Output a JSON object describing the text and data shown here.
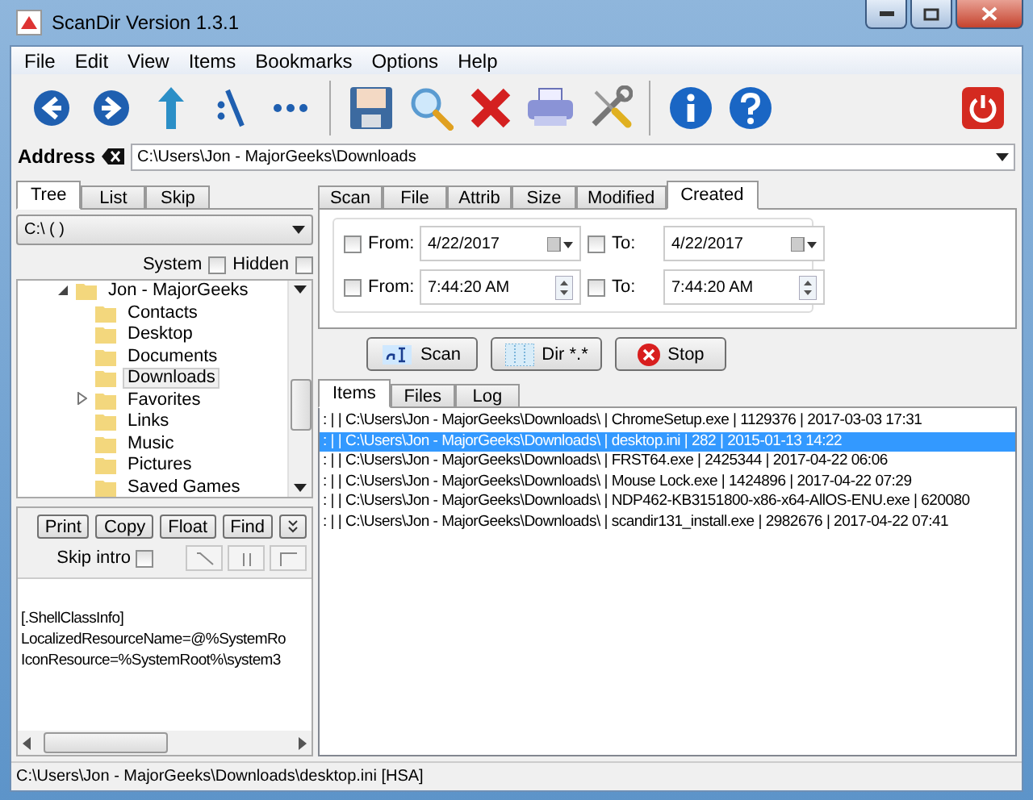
{
  "window": {
    "title": "ScanDir Version 1.3.1"
  },
  "menu": [
    "File",
    "Edit",
    "View",
    "Items",
    "Bookmarks",
    "Options",
    "Help"
  ],
  "address": {
    "label": "Address",
    "value": "C:\\Users\\Jon - MajorGeeks\\Downloads"
  },
  "left_tabs": [
    {
      "label": "Tree",
      "selected": true
    },
    {
      "label": "List",
      "selected": false
    },
    {
      "label": "Skip",
      "selected": false
    }
  ],
  "drive": "C:\\ ( )",
  "tree_options": [
    {
      "label": "System",
      "checked": false
    },
    {
      "label": "Hidden",
      "checked": false
    }
  ],
  "tree": [
    {
      "label": "Jon - MajorGeeks",
      "expanded": true,
      "selected": false,
      "children": [
        {
          "label": "Contacts",
          "selected": false
        },
        {
          "label": "Desktop",
          "selected": false
        },
        {
          "label": "Documents",
          "selected": false
        },
        {
          "label": "Downloads",
          "selected": true
        },
        {
          "label": "Favorites",
          "selected": false,
          "expanded": false
        },
        {
          "label": "Links",
          "selected": false
        },
        {
          "label": "Music",
          "selected": false
        },
        {
          "label": "Pictures",
          "selected": false
        },
        {
          "label": "Saved Games",
          "selected": false
        }
      ]
    }
  ],
  "preview_buttons": [
    "Print",
    "Copy",
    "Float",
    "Find"
  ],
  "skip_intro": {
    "label": "Skip intro",
    "checked": false
  },
  "preview_lines": [
    "[.ShellClassInfo]",
    "LocalizedResourceName=@%SystemRo",
    "IconResource=%SystemRoot%\\system3"
  ],
  "right_tabs": [
    {
      "label": "Scan",
      "selected": false
    },
    {
      "label": "File",
      "selected": false
    },
    {
      "label": "Attrib",
      "selected": false
    },
    {
      "label": "Size",
      "selected": false
    },
    {
      "label": "Modified",
      "selected": false
    },
    {
      "label": "Created",
      "selected": true
    }
  ],
  "filters": [
    {
      "kind": "date",
      "from": {
        "label": "From:",
        "checked": false,
        "value": "4/22/2017"
      },
      "to": {
        "label": "To:",
        "checked": false,
        "value": "4/22/2017"
      }
    },
    {
      "kind": "time",
      "from": {
        "label": "From:",
        "checked": false,
        "value": "7:44:20 AM"
      },
      "to": {
        "label": "To:",
        "checked": false,
        "value": "7:44:20 AM"
      }
    }
  ],
  "actions": [
    {
      "kind": "scan",
      "label": "Scan"
    },
    {
      "kind": "dir",
      "label": "Dir *.*"
    },
    {
      "kind": "stop",
      "label": "Stop"
    }
  ],
  "result_tabs": [
    {
      "label": "Items",
      "selected": true
    },
    {
      "label": "Files",
      "selected": false
    },
    {
      "label": "Log",
      "selected": false
    }
  ],
  "results": [
    {
      "text": ": |  | C:\\Users\\Jon - MajorGeeks\\Downloads\\ | ChromeSetup.exe | 1129376 | 2017-03-03 17:31",
      "selected": false
    },
    {
      "text": ": |  | C:\\Users\\Jon - MajorGeeks\\Downloads\\ | desktop.ini | 282 | 2015-01-13 14:22",
      "selected": true
    },
    {
      "text": ": |  | C:\\Users\\Jon - MajorGeeks\\Downloads\\ | FRST64.exe | 2425344 | 2017-04-22 06:06",
      "selected": false
    },
    {
      "text": ": |  | C:\\Users\\Jon - MajorGeeks\\Downloads\\ | Mouse Lock.exe | 1424896 | 2017-04-22 07:29",
      "selected": false
    },
    {
      "text": ": |  | C:\\Users\\Jon - MajorGeeks\\Downloads\\ | NDP462-KB3151800-x86-x64-AllOS-ENU.exe | 620080",
      "selected": false
    },
    {
      "text": ": |  | C:\\Users\\Jon - MajorGeeks\\Downloads\\ | scandir131_install.exe | 2982676 | 2017-04-22 07:41",
      "selected": false
    }
  ],
  "status_bar": "C:\\Users\\Jon - MajorGeeks\\Downloads\\desktop.ini  [HSA]"
}
